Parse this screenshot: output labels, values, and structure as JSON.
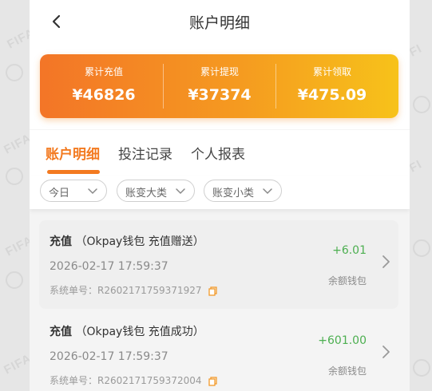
{
  "header": {
    "title": "账户明细",
    "back_icon": "chevron-left-icon"
  },
  "summary": {
    "items": [
      {
        "label": "累计充值",
        "value": "¥46826"
      },
      {
        "label": "累计提现",
        "value": "¥37374"
      },
      {
        "label": "累计领取",
        "value": "¥475.09"
      }
    ],
    "gradient_start": "#f37527",
    "gradient_end": "#f7c21a"
  },
  "tabs": [
    {
      "label": "账户明细",
      "active": true
    },
    {
      "label": "投注记录",
      "active": false
    },
    {
      "label": "个人报表",
      "active": false
    }
  ],
  "filters": [
    {
      "label": "今日"
    },
    {
      "label": "账变大类"
    },
    {
      "label": "账变小类"
    }
  ],
  "records": [
    {
      "type": "充值",
      "detail": "（Okpay钱包 充值赠送）",
      "time": "2026-02-17 17:59:37",
      "order": "系统单号：R2602171759371927",
      "amount": "+6.01",
      "wallet": "余额钱包"
    },
    {
      "type": "充值",
      "detail": "（Okpay钱包 充值成功）",
      "time": "2026-02-17 17:59:37",
      "order": "系统单号：R2602171759372004",
      "amount": "+601.00",
      "wallet": "余额钱包"
    }
  ],
  "colors": {
    "accent": "#f37a20",
    "positive": "#4caf50"
  }
}
